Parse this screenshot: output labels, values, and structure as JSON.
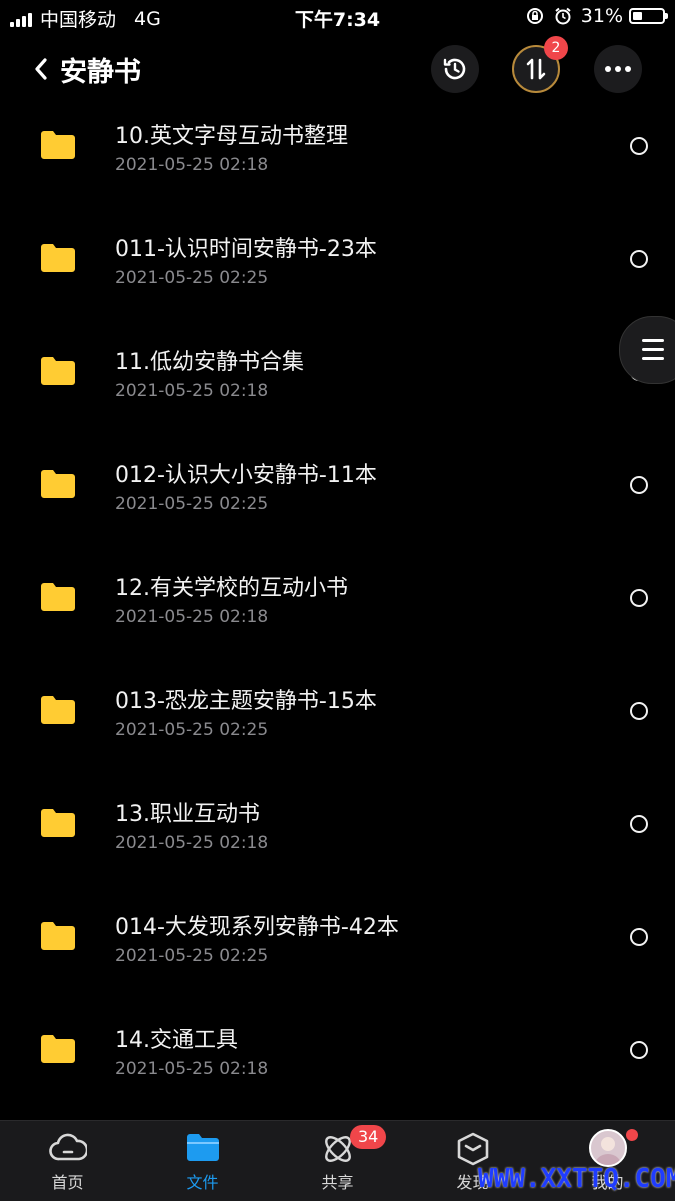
{
  "status_bar": {
    "carrier": "中国移动",
    "network": "4G",
    "time": "下午7:34",
    "battery": "31%",
    "battery_level": 0.31
  },
  "header": {
    "title": "安静书",
    "transfer_badge": "2",
    "icons": [
      "back-icon",
      "history-icon",
      "transfer-icon",
      "more-icon"
    ]
  },
  "files": [
    {
      "name": "10.英文字母互动书整理",
      "date": "2021-05-25 02:18"
    },
    {
      "name": "011-认识时间安静书-23本",
      "date": "2021-05-25 02:25"
    },
    {
      "name": "11.低幼安静书合集",
      "date": "2021-05-25 02:18"
    },
    {
      "name": "012-认识大小安静书-11本",
      "date": "2021-05-25 02:25"
    },
    {
      "name": "12.有关学校的互动小书",
      "date": "2021-05-25 02:18"
    },
    {
      "name": "013-恐龙主题安静书-15本",
      "date": "2021-05-25 02:25"
    },
    {
      "name": "13.职业互动书",
      "date": "2021-05-25 02:18"
    },
    {
      "name": "014-大发现系列安静书-42本",
      "date": "2021-05-25 02:25"
    },
    {
      "name": "14.交通工具",
      "date": "2021-05-25 02:18"
    }
  ],
  "tabbar": {
    "tabs": [
      {
        "label": "首页",
        "icon": "cloud-icon"
      },
      {
        "label": "文件",
        "icon": "folder-icon"
      },
      {
        "label": "共享",
        "icon": "share-icon"
      },
      {
        "label": "发现",
        "icon": "discover-icon"
      },
      {
        "label": "我的",
        "icon": "avatar"
      }
    ],
    "share_badge": "34",
    "active_color": "#1d9bf0"
  },
  "watermark": "WWW.XXTTQ.COM",
  "colors": {
    "folder": "#ffcc33",
    "badge": "#f0464a",
    "transfer_ring": "#b88a3b"
  }
}
